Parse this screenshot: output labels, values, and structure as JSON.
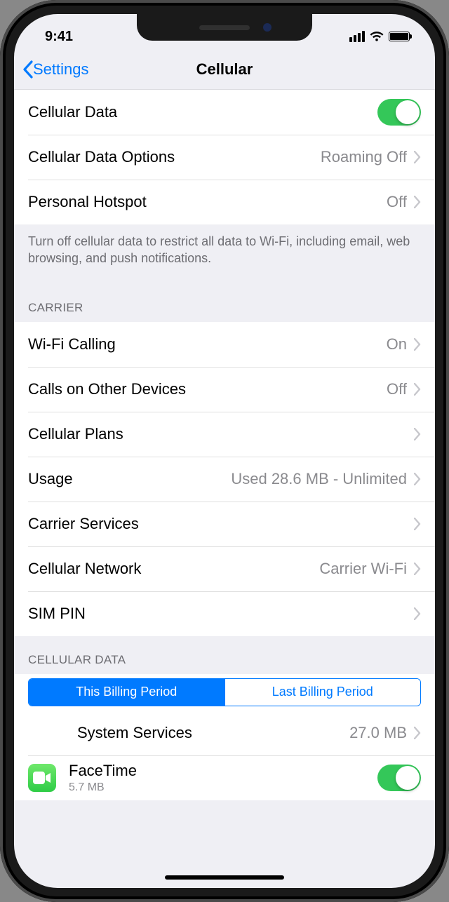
{
  "status": {
    "time": "9:41"
  },
  "nav": {
    "back_label": "Settings",
    "title": "Cellular"
  },
  "sec1": {
    "cellular_data": {
      "label": "Cellular Data",
      "on": true
    },
    "cellular_data_options": {
      "label": "Cellular Data Options",
      "value": "Roaming Off"
    },
    "personal_hotspot": {
      "label": "Personal Hotspot",
      "value": "Off"
    },
    "footer": "Turn off cellular data to restrict all data to Wi-Fi, including email, web browsing, and push notifications."
  },
  "carrier": {
    "header": "CARRIER",
    "wifi_calling": {
      "label": "Wi-Fi Calling",
      "value": "On"
    },
    "other_devices": {
      "label": "Calls on Other Devices",
      "value": "Off"
    },
    "plans": {
      "label": "Cellular Plans",
      "value": ""
    },
    "usage": {
      "label": "Usage",
      "value": "Used 28.6 MB - Unlimited"
    },
    "services": {
      "label": "Carrier Services",
      "value": ""
    },
    "network": {
      "label": "Cellular Network",
      "value": "Carrier Wi-Fi"
    },
    "sim_pin": {
      "label": "SIM PIN",
      "value": ""
    }
  },
  "data_usage": {
    "header": "CELLULAR DATA",
    "segments": {
      "a": "This Billing Period",
      "b": "Last Billing Period",
      "active": "a"
    },
    "system_services": {
      "label": "System Services",
      "value": "27.0 MB"
    },
    "facetime": {
      "label": "FaceTime",
      "sub": "5.7 MB",
      "on": true
    }
  }
}
